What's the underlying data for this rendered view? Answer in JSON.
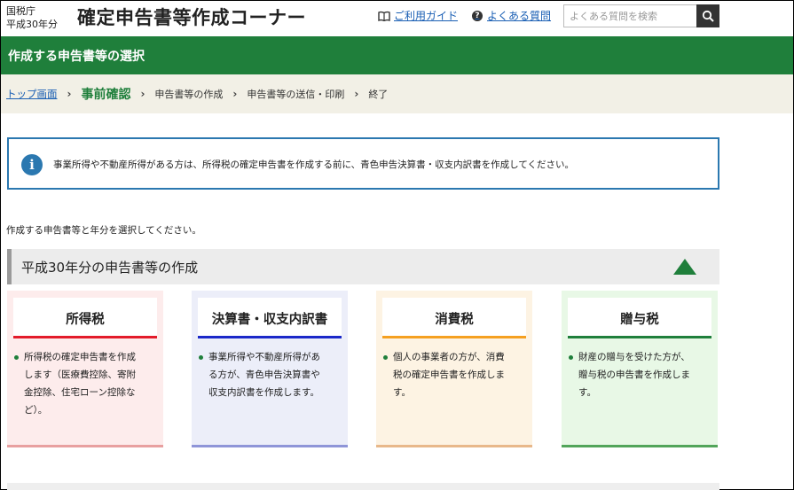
{
  "header": {
    "agency": "国税庁",
    "year": "平成30年分",
    "title": "確定申告書等作成コーナー",
    "guide_label": "ご利用ガイド",
    "faq_label": "よくある質問",
    "faq_icon_glyph": "?",
    "search_placeholder": "よくある質問を検索"
  },
  "page_heading": "作成する申告書等の選択",
  "breadcrumb": {
    "sep": "›",
    "top": "トップ画面",
    "current": "事前確認",
    "step_create": "申告書等の作成",
    "step_send": "申告書等の送信・印刷",
    "step_end": "終了"
  },
  "info": {
    "icon_glyph": "i",
    "message": "事業所得や不動産所得がある方は、所得税の確定申告書を作成する前に、青色申告決算書・収支内訳書を作成してください。"
  },
  "intro": "作成する申告書等と年分を選択してください。",
  "section": {
    "title": "平成30年分の申告書等の作成"
  },
  "cards": [
    {
      "title": "所得税",
      "lines": [
        "所得税の確定申告書を作成",
        "します（医療費控除、寄附",
        "金控除、住宅ローン控除な",
        "ど）。"
      ]
    },
    {
      "title": "決算書・収支内訳書",
      "lines": [
        "事業所得や不動産所得があ",
        "る方が、青色申告決算書や",
        "収支内訳書を作成します。"
      ]
    },
    {
      "title": "消費税",
      "lines": [
        "個人の事業者の方が、消費",
        "税の確定申告書を作成しま",
        "す。"
      ]
    },
    {
      "title": "贈与税",
      "lines": [
        "財産の贈与を受けた方が、",
        "贈与税の申告書を作成しま",
        "す。"
      ]
    }
  ],
  "colors": {
    "brand_green": "#1f7f3b",
    "info_blue": "#2b78b0",
    "link_blue": "#1a5fb4",
    "card_shotoku": "#e31b2a",
    "card_kessan": "#1a28c9",
    "card_shohi": "#f5a020",
    "card_zoyo": "#1f7f3b"
  },
  "icons": {
    "guide": "book-icon",
    "faq": "question-circle-icon",
    "search": "search-icon",
    "info": "info-icon",
    "toggle": "collapse-triangle-icon",
    "bullet": "bullet-dot-icon"
  }
}
